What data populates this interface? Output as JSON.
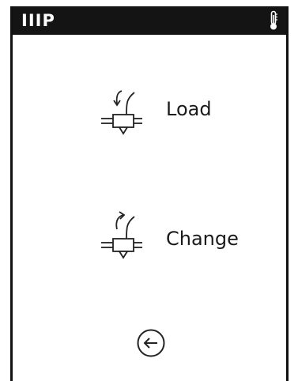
{
  "header": {
    "logo": "IIIP",
    "status_icon": "thermometer-icon"
  },
  "menu": {
    "items": [
      {
        "label": "Load",
        "icon": "filament-load-icon"
      },
      {
        "label": "Change",
        "icon": "filament-change-icon"
      }
    ]
  },
  "footer": {
    "back_icon": "back-arrow-icon"
  }
}
